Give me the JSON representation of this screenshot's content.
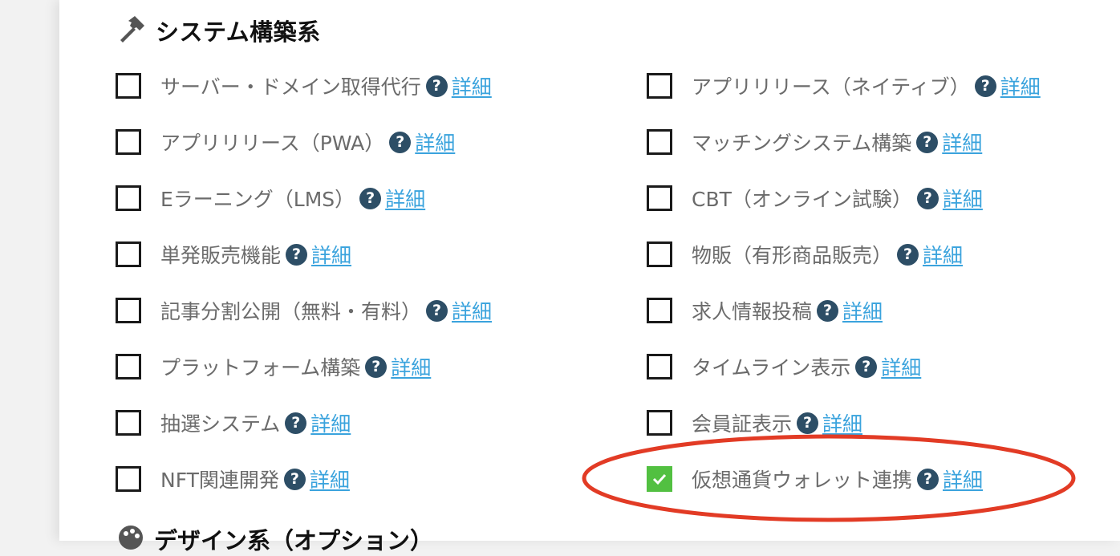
{
  "section": {
    "title": "システム構築系",
    "icon": "hammer-icon"
  },
  "next_section": {
    "title": "デザイン系（オプション）",
    "icon": "palette-icon"
  },
  "help_glyph": "?",
  "left_options": [
    {
      "label": "サーバー・ドメイン取得代行",
      "detail": "詳細",
      "checked": false
    },
    {
      "label": "アプリリリース（PWA）",
      "detail": "詳細",
      "checked": false
    },
    {
      "label": "Eラーニング（LMS）",
      "detail": "詳細",
      "checked": false
    },
    {
      "label": "単発販売機能",
      "detail": "詳細",
      "checked": false
    },
    {
      "label": "記事分割公開（無料・有料）",
      "detail": "詳細",
      "checked": false
    },
    {
      "label": "プラットフォーム構築",
      "detail": "詳細",
      "checked": false
    },
    {
      "label": "抽選システム",
      "detail": "詳細",
      "checked": false
    },
    {
      "label": "NFT関連開発",
      "detail": "詳細",
      "checked": false
    }
  ],
  "right_options": [
    {
      "label": "アプリリリース（ネイティブ）",
      "detail": "詳細",
      "checked": false
    },
    {
      "label": "マッチングシステム構築",
      "detail": "詳細",
      "checked": false
    },
    {
      "label": "CBT（オンライン試験）",
      "detail": "詳細",
      "checked": false
    },
    {
      "label": "物販（有形商品販売）",
      "detail": "詳細",
      "checked": false
    },
    {
      "label": "求人情報投稿",
      "detail": "詳細",
      "checked": false
    },
    {
      "label": "タイムライン表示",
      "detail": "詳細",
      "checked": false
    },
    {
      "label": "会員証表示",
      "detail": "詳細",
      "checked": false
    },
    {
      "label": "仮想通貨ウォレット連携",
      "detail": "詳細",
      "checked": true
    }
  ],
  "colors": {
    "checked": "#52c041",
    "help": "#2d4e66",
    "link": "#3aa3dd",
    "annotation": "#e23b25"
  }
}
